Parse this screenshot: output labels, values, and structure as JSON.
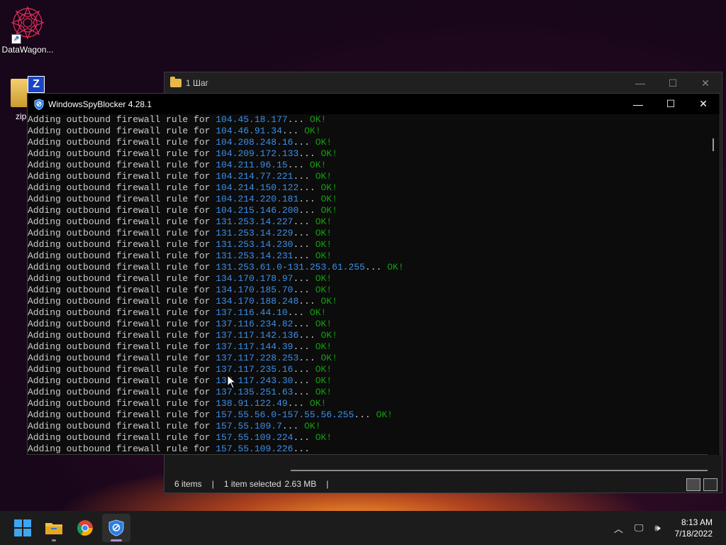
{
  "desktop": {
    "icons": [
      {
        "label": "DataWagon..."
      },
      {
        "label": "zip"
      }
    ]
  },
  "explorer": {
    "title": "1 Шаг",
    "status": {
      "items": "6 items",
      "sep1": "|",
      "selected": "1 item selected",
      "size": "2.63 MB",
      "sep2": "|"
    }
  },
  "console": {
    "title": "WindowsSpyBlocker 4.28.1",
    "prefix": "Adding outbound firewall rule for ",
    "lines": [
      {
        "ip": "104.45.18.177",
        "status": "OK!"
      },
      {
        "ip": "104.46.91.34",
        "status": "OK!"
      },
      {
        "ip": "104.208.248.16",
        "status": "OK!"
      },
      {
        "ip": "104.209.172.133",
        "status": "OK!"
      },
      {
        "ip": "104.211.96.15",
        "status": "OK!"
      },
      {
        "ip": "104.214.77.221",
        "status": "OK!"
      },
      {
        "ip": "104.214.150.122",
        "status": "OK!"
      },
      {
        "ip": "104.214.220.181",
        "status": "OK!"
      },
      {
        "ip": "104.215.146.200",
        "status": "OK!"
      },
      {
        "ip": "131.253.14.227",
        "status": "OK!"
      },
      {
        "ip": "131.253.14.229",
        "status": "OK!"
      },
      {
        "ip": "131.253.14.230",
        "status": "OK!"
      },
      {
        "ip": "131.253.14.231",
        "status": "OK!"
      },
      {
        "ip": "131.253.61.0-131.253.61.255",
        "status": "OK!"
      },
      {
        "ip": "134.170.178.97",
        "status": "OK!"
      },
      {
        "ip": "134.170.185.70",
        "status": "OK!"
      },
      {
        "ip": "134.170.188.248",
        "status": "OK!"
      },
      {
        "ip": "137.116.44.10",
        "status": "OK!"
      },
      {
        "ip": "137.116.234.82",
        "status": "OK!"
      },
      {
        "ip": "137.117.142.136",
        "status": "OK!"
      },
      {
        "ip": "137.117.144.39",
        "status": "OK!"
      },
      {
        "ip": "137.117.228.253",
        "status": "OK!"
      },
      {
        "ip": "137.117.235.16",
        "status": "OK!"
      },
      {
        "ip": "137.117.243.30",
        "status": "OK!"
      },
      {
        "ip": "137.135.251.63",
        "status": "OK!"
      },
      {
        "ip": "138.91.122.49",
        "status": "OK!"
      },
      {
        "ip": "157.55.56.0-157.55.56.255",
        "status": "OK!"
      },
      {
        "ip": "157.55.109.7",
        "status": "OK!"
      },
      {
        "ip": "157.55.109.224",
        "status": "OK!"
      },
      {
        "ip": "157.55.109.226",
        "status": ""
      }
    ]
  },
  "taskbar": {
    "clock_time": "8:13 AM",
    "clock_date": "7/18/2022"
  },
  "colors": {
    "ip": "#3b8eea",
    "ok": "#13a10e",
    "console_text": "#cccccc"
  }
}
